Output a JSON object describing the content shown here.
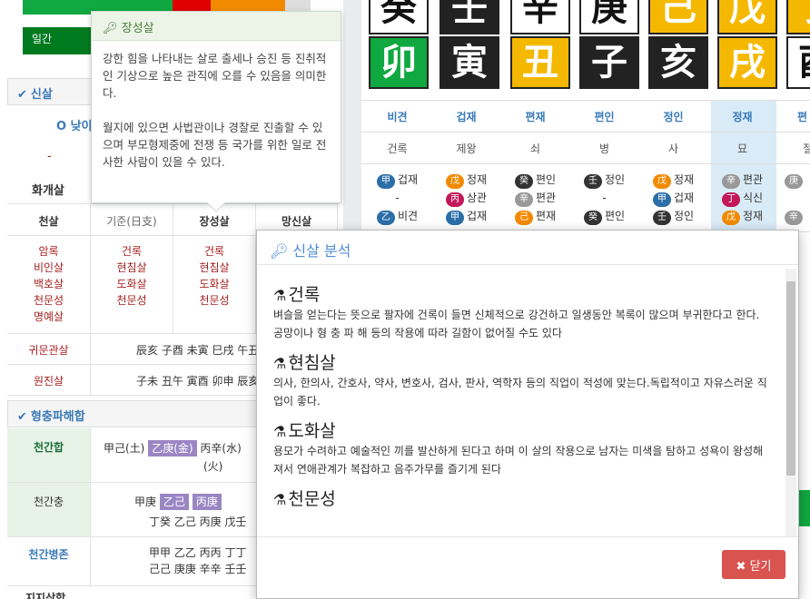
{
  "left": {
    "ilgan_label": "일간",
    "sinsal_header": "신살",
    "radio_label": "O 낮이",
    "dash": "-",
    "hwagaesal": "화개살",
    "sub_headers": [
      "천살",
      "기준(日支)",
      "장성살",
      "망신살"
    ],
    "col1": [
      "암록",
      "비인살",
      "백호살",
      "천문성",
      "명예살"
    ],
    "col2": [
      "건록",
      "현침살",
      "도화살",
      "천문성"
    ],
    "col3": [
      "건록",
      "현침살",
      "도화살",
      "천문성"
    ],
    "gwimun_label": "귀문관살",
    "gwimun_value": "辰亥 子酉 未寅 巳戌 午丑",
    "wonjin_label": "원진살",
    "wonjin_value": "子未 丑午 寅酉 卯申 辰亥",
    "hyeongchung_header": "형충파해합",
    "cheonganhap_label": "천간합",
    "cheonganhap_a": "甲己(土)",
    "cheonganhap_hl": "乙庚(金)",
    "cheonganhap_b": "丙辛(水)",
    "cheonganhap_c": "(火)",
    "cheonganchung_label": "천간충",
    "cheonganchung_a": "甲庚",
    "cheonganchung_hl1": "乙己",
    "cheonganchung_hl2": "丙庚",
    "cheonganchung_b": "丁癸 乙己 丙庚 戊壬",
    "byeongjon_label": "천간병존",
    "byeongjon_a": "甲甲 乙乙 丙丙 丁丁",
    "byeongjon_b": "己己 庚庚 辛辛 壬壬",
    "jiji_label": "지지삼합"
  },
  "pillars": {
    "stems": [
      "癸",
      "壬",
      "辛",
      "庚",
      "己",
      "戊",
      "丁"
    ],
    "branches": [
      "卯",
      "寅",
      "丑",
      "子",
      "亥",
      "戌",
      "酉"
    ],
    "tengods": [
      "비견",
      "겁재",
      "편재",
      "편인",
      "정인",
      "정재",
      "편"
    ],
    "twelve": [
      "건록",
      "제왕",
      "쇠",
      "병",
      "사",
      "묘",
      "절"
    ],
    "hidden": [
      [
        [
          "甲",
          "겁재"
        ],
        [
          "-",
          ""
        ],
        [
          "乙",
          "비견"
        ]
      ],
      [
        [
          "戊",
          "정재"
        ],
        [
          "丙",
          "상관"
        ],
        [
          "甲",
          "겁재"
        ]
      ],
      [
        [
          "癸",
          "편인"
        ],
        [
          "辛",
          "편관"
        ],
        [
          "己",
          "편재"
        ]
      ],
      [
        [
          "壬",
          "정인"
        ],
        [
          "-",
          ""
        ],
        [
          "癸",
          "편인"
        ]
      ],
      [
        [
          "戊",
          "정재"
        ],
        [
          "甲",
          "겁재"
        ],
        [
          "壬",
          "정인"
        ]
      ],
      [
        [
          "辛",
          "편관"
        ],
        [
          "丁",
          "식신"
        ],
        [
          "戊",
          "정재"
        ]
      ],
      [
        [
          "庚",
          ""
        ],
        [
          "",
          ""
        ],
        [
          "辛",
          ""
        ]
      ]
    ]
  },
  "tooltip": {
    "title": "장성살",
    "body1": "강한 힘을 나타내는 살로 출세나 승진 등 진취적인 기상으로 높은 관직에 오를 수 있음을 의미한다.",
    "body2": "월지에 있으면 사법관이나 경찰로 진출할 수 있으며 부모형제중에 전쟁 등 국가를 위한 일로 전사한 사람이 있을 수 있다."
  },
  "modal": {
    "title": "신살 분석",
    "items": [
      {
        "title": "건록",
        "desc": "벼슬을 얻는다는 뜻으로 팔자에 건록이 들면 신체적으로 강건하고 일생동안 복록이 많으며 부귀한다고 한다. 공망이나 형 충 파 해 등의 작용에 따라 길함이 없어질 수도 있다"
      },
      {
        "title": "현침살",
        "desc": "의사, 한의사, 간호사, 약사, 변호사, 검사, 판사, 역학자 등의 직업이 적성에 맞는다.독립적이고 자유스러운 직업이 좋다."
      },
      {
        "title": "도화살",
        "desc": "용모가 수려하고 예술적인 끼를 발산하게 된다고 하며 이 살의 작용으로 남자는 미색을 탐하고 성욕이 왕성해져서 연애관계가 복잡하고 음주가무를 즐기게 된다"
      },
      {
        "title": "천문성",
        "desc": ""
      }
    ],
    "close_label": "닫기"
  },
  "icons": {
    "key": "key-icon",
    "check": "check-icon",
    "flask": "flask-icon",
    "close": "close-icon"
  },
  "colors": {
    "green": "#10a840",
    "black": "#222222",
    "yellow": "#f5b800",
    "purple": "#9b86c4",
    "danger": "#d9534f",
    "link": "#3a7ab8"
  }
}
